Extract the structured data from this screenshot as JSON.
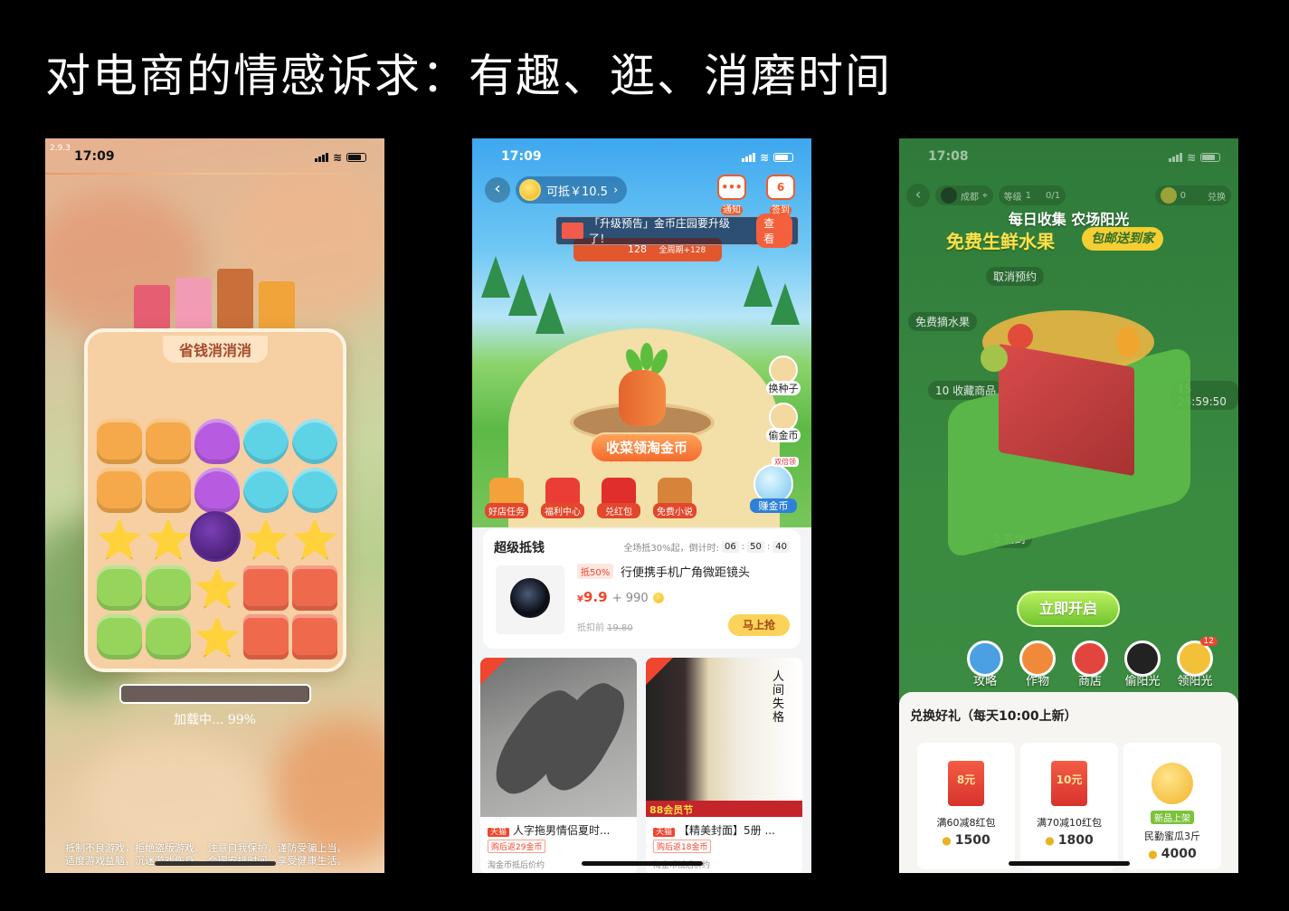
{
  "slide_title": "对电商的情感诉求：有趣、逛、消磨时间",
  "phone1": {
    "version": "2.9.3",
    "time": "17:09",
    "game_title": "省钱消消消",
    "loading_text": "加载中... 99%",
    "progress": 0.99,
    "notice_line1": "抵制不良游戏，拒绝盗版游戏。 注意自我保护，谨防受骗上当。",
    "notice_line2": "适度游戏益脑，沉迷游戏伤身。 合理安排时间，享受健康生活。"
  },
  "phone2": {
    "time": "17:09",
    "coin_label": "可抵￥10.5",
    "notify_label": "通知",
    "signin_label": "签到",
    "signin_day": "6",
    "banner_text": "「升级预告」金币庄园要升级了！",
    "banner_action": "查看",
    "ribbon_value": "128",
    "ribbon_week": "全周期+128",
    "side_actions": [
      "换种子",
      "偷金币"
    ],
    "harvest_button": "收菜领淘金币",
    "mini_icons": [
      "好店任务",
      "福利中心",
      "兑红包",
      "免费小说"
    ],
    "earn_tag": "双倍领",
    "earn_label": "赚金币",
    "deal": {
      "title": "超级抵钱",
      "meta": "全场抵30%起，倒计时:",
      "countdown": [
        "06",
        "50",
        "40"
      ],
      "badge": "抵50%",
      "product": "行便携手机广角微距镜头",
      "price_symbol": "¥",
      "price": "9.9",
      "plus_coins": "+ 990",
      "orig_label": "抵扣前",
      "orig_price": "19.80",
      "button": "马上抢"
    },
    "cards": [
      {
        "tag": "天猫",
        "title": "人字拖男情侣夏时...",
        "cashback": "购后返29金币",
        "after": "淘金币抵后价约"
      },
      {
        "tag": "天猫",
        "title": "【精美封面】5册 ...",
        "cashback": "购后返18金币",
        "after": "淘金币抵后价约"
      }
    ],
    "card2_cover": "人间失格",
    "card2_badge": "88会员节"
  },
  "phone3": {
    "time": "17:08",
    "user_city": "成都",
    "level_label": "等级",
    "level_value": "1",
    "exp": "0/1",
    "sun_count": "0",
    "collect_btn": "兑换",
    "hero_line1": "每日收集 农场阳光",
    "hero_line2": "免费生鲜水果",
    "hero_badge": "包邮送到家",
    "faded_tags": [
      "取消预约",
      "免费摘水果",
      "10 收藏商品",
      "15 23:59:50",
      "2 签到"
    ],
    "open_button": "立即开启",
    "nav": [
      "攻略",
      "作物",
      "商店",
      "偷阳光",
      "领阳光"
    ],
    "nav_badge": "12",
    "gifts_title": "兑换好礼（每天10:00上新）",
    "gifts": [
      {
        "face": "8元",
        "name": "满60减8红包",
        "cost": "1500"
      },
      {
        "face": "10元",
        "name": "满70减10红包",
        "cost": "1800"
      },
      {
        "face": "新品上架",
        "name": "民勤蜜瓜3斤",
        "cost": "4000"
      }
    ]
  },
  "colors": {
    "accent_orange": "#f36b2c",
    "taobao_red": "#f0452e",
    "farm_green": "#3a8a40"
  }
}
